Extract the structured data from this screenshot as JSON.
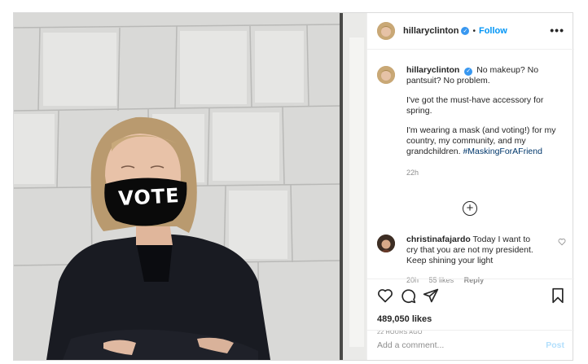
{
  "header": {
    "username": "hillaryclinton",
    "verified_icon": "verified-badge-icon",
    "separator": "•",
    "follow_label": "Follow",
    "more_icon": "more-options-icon",
    "more_label": "•••"
  },
  "caption": {
    "username": "hillaryclinton",
    "first_line": "No makeup? No pantsuit? No problem.",
    "paragraph_2": "I've got the must-have accessory for spring.",
    "paragraph_3": "I'm wearing a mask (and voting!) for my country, my community, and my grandchildren.",
    "hashtag": "#MaskingForAFriend",
    "time": "22h"
  },
  "load_more": {
    "icon": "plus-circle-icon",
    "label": "+"
  },
  "comment": {
    "username": "christinafajardo",
    "text": "Today I want to cry that you are not my president. Keep shining your light",
    "time": "20h",
    "likes": "55 likes",
    "reply_label": "Reply",
    "like_icon": "heart-outline-icon"
  },
  "actions": {
    "like_icon": "heart-icon",
    "comment_icon": "comment-icon",
    "share_icon": "paper-plane-icon",
    "save_icon": "bookmark-icon",
    "likes_count": "489,050 likes",
    "posted_ago": "22 HOURS AGO"
  },
  "add_comment": {
    "placeholder": "Add a comment...",
    "post_label": "Post"
  },
  "photo": {
    "mask_text": "VOTE"
  },
  "colors": {
    "accent": "#0095f6",
    "verified": "#3897f0",
    "hashtag": "#00376b",
    "muted": "#8e8e8e",
    "post_disabled": "#b2dffc"
  }
}
